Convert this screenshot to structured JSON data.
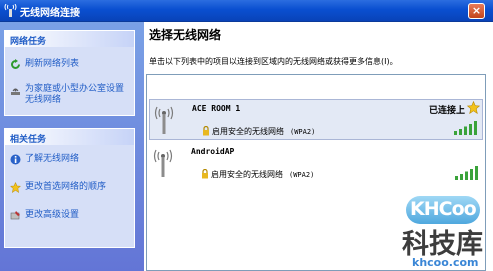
{
  "window": {
    "title": "无线网络连接",
    "close_glyph": "×"
  },
  "sidebar": {
    "network_tasks": {
      "header": "网络任务",
      "items": [
        {
          "label": "刷新网络列表",
          "icon": "refresh-icon"
        },
        {
          "label": "为家庭或小型办公室设置无线网络",
          "icon": "setup-network-icon"
        }
      ]
    },
    "related_tasks": {
      "header": "相关任务",
      "items": [
        {
          "label": "了解无线网络",
          "icon": "info-icon"
        },
        {
          "label": "更改首选网络的顺序",
          "icon": "star-icon"
        },
        {
          "label": "更改高级设置",
          "icon": "settings-icon"
        }
      ]
    }
  },
  "main": {
    "title": "选择无线网络",
    "description": "单击以下列表中的项目以连接到区域内的无线网络或获得更多信息(I)。",
    "networks": [
      {
        "name": "ACE ROOM 1",
        "status": "已连接上",
        "security": "启用安全的无线网络",
        "protocol": "(WPA2)",
        "signal_bars": 5,
        "preferred": true,
        "selected": true
      },
      {
        "name": "AndroidAP",
        "status": "",
        "security": "启用安全的无线网络",
        "protocol": "(WPA2)",
        "signal_bars": 5,
        "preferred": false,
        "selected": false
      }
    ]
  },
  "watermark": {
    "logo": "KHCoo",
    "name": "科技库",
    "url": "khcoo.com"
  },
  "colors": {
    "titlebar": "#0a4fd0",
    "sidebar": "#6375d6",
    "link": "#215dc6",
    "signal": "#3aa33a"
  }
}
